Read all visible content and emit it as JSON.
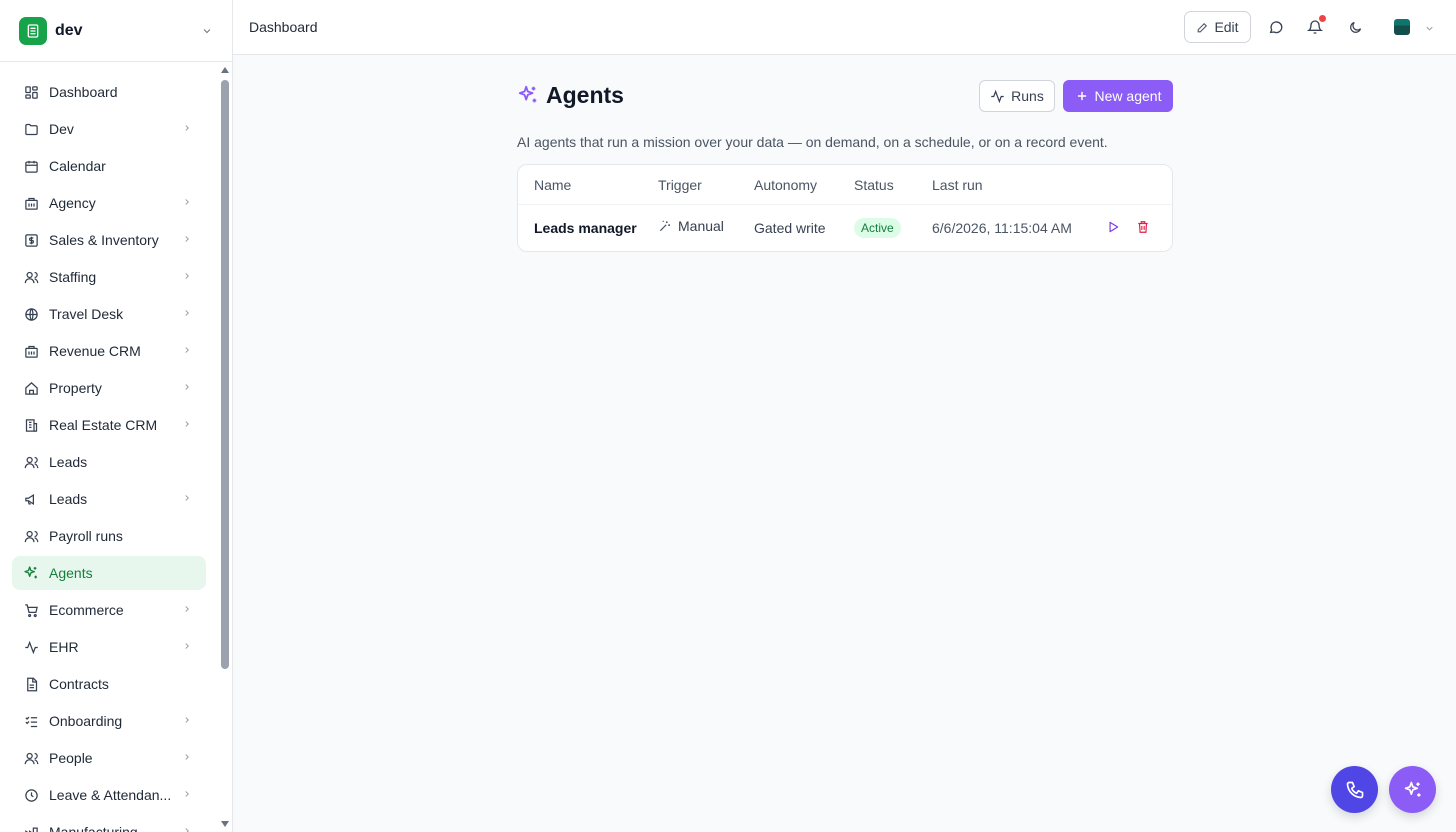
{
  "workspace": {
    "name": "dev"
  },
  "sidebar": {
    "items": [
      {
        "label": "Dashboard",
        "icon": "layout-grid-icon",
        "chevron": false,
        "active": false
      },
      {
        "label": "Dev",
        "icon": "folder-icon",
        "chevron": true,
        "active": false
      },
      {
        "label": "Calendar",
        "icon": "calendar-icon",
        "chevron": false,
        "active": false
      },
      {
        "label": "Agency",
        "icon": "building-icon",
        "chevron": true,
        "active": false
      },
      {
        "label": "Sales & Inventory",
        "icon": "dollar-icon",
        "chevron": true,
        "active": false
      },
      {
        "label": "Staffing",
        "icon": "users-icon",
        "chevron": true,
        "active": false
      },
      {
        "label": "Travel Desk",
        "icon": "globe-icon",
        "chevron": true,
        "active": false
      },
      {
        "label": "Revenue CRM",
        "icon": "building-icon",
        "chevron": true,
        "active": false
      },
      {
        "label": "Property",
        "icon": "home-icon",
        "chevron": true,
        "active": false
      },
      {
        "label": "Real Estate CRM",
        "icon": "office-building-icon",
        "chevron": true,
        "active": false
      },
      {
        "label": "Leads",
        "icon": "users-icon",
        "chevron": false,
        "active": false
      },
      {
        "label": "Leads",
        "icon": "megaphone-icon",
        "chevron": true,
        "active": false
      },
      {
        "label": "Payroll runs",
        "icon": "users-icon",
        "chevron": false,
        "active": false
      },
      {
        "label": "Agents",
        "icon": "sparkles-icon",
        "chevron": false,
        "active": true
      },
      {
        "label": "Ecommerce",
        "icon": "cart-icon",
        "chevron": true,
        "active": false
      },
      {
        "label": "EHR",
        "icon": "activity-icon",
        "chevron": true,
        "active": false
      },
      {
        "label": "Contracts",
        "icon": "file-text-icon",
        "chevron": false,
        "active": false
      },
      {
        "label": "Onboarding",
        "icon": "list-checks-icon",
        "chevron": true,
        "active": false
      },
      {
        "label": "People",
        "icon": "users-icon",
        "chevron": true,
        "active": false
      },
      {
        "label": "Leave & Attendan...",
        "icon": "clock-icon",
        "chevron": true,
        "active": false
      },
      {
        "label": "Manufacturing",
        "icon": "factory-icon",
        "chevron": true,
        "active": false
      }
    ]
  },
  "topbar": {
    "breadcrumb": "Dashboard",
    "edit_label": "Edit"
  },
  "main": {
    "title": "Agents",
    "runs_label": "Runs",
    "new_agent_label": "New agent",
    "description": "AI agents that run a mission over your data — on demand, on a schedule, or on a record event.",
    "table": {
      "columns": [
        "Name",
        "Trigger",
        "Autonomy",
        "Status",
        "Last run"
      ],
      "rows": [
        {
          "name": "Leads manager",
          "trigger": "Manual",
          "autonomy": "Gated write",
          "status": "Active",
          "last_run": "6/6/2026, 11:15:04 AM"
        }
      ]
    }
  },
  "colors": {
    "brand_green": "#16a34a",
    "accent_purple": "#8b5cf6",
    "call_indigo": "#4f46e5",
    "active_bg": "#e8f7ee",
    "danger": "#e11d48"
  }
}
